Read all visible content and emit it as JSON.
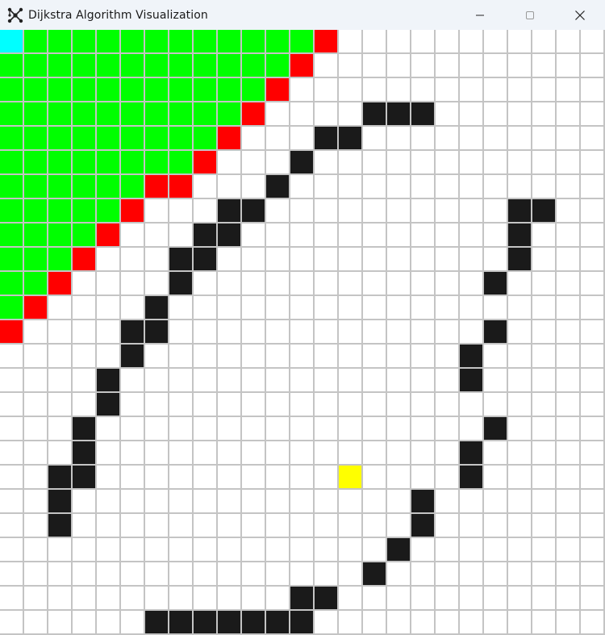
{
  "window": {
    "title": "Dijkstra Algorithm Visualization",
    "icon": "network-nodes-icon",
    "controls": [
      "minimize-icon",
      "maximize-icon",
      "close-icon"
    ]
  },
  "colors": {
    "empty": "#ffffff",
    "wall": "#1a1a1a",
    "visited": "#00ff00",
    "frontier": "#ff0000",
    "start": "#00ffff",
    "end": "#ffff00",
    "gridline": "#c4c4c4"
  },
  "grid": {
    "rows": 25,
    "cols": 25,
    "cells": [
      "SVVVVVVVVVVVVF...........",
      "VVVVVVVVVVVVF............",
      "VVVVVVVVVVVF.............",
      "VVVVVVVVVVF....WWW.......",
      "VVVVVVVVVF...WW..........",
      "VVVVVVVVF...W............",
      "VVVVVVFF...W.............",
      "VVVVVF...WW..........WW..",
      "VVVVF...WW...........W...",
      "VVVF...WW............W...",
      "VVF....W............W....",
      "VF....W..................",
      "F....WW.............W....",
      ".....W.............W.....",
      "....W..............W.....",
      "....W....................",
      "...W................W....",
      "...W...............W.....",
      "..WW..........E....W.....",
      "..W..............W.......",
      "..W..............W.......",
      "................W........",
      "...............W.........",
      "............WW...........",
      "......WWWWWWW............"
    ]
  }
}
